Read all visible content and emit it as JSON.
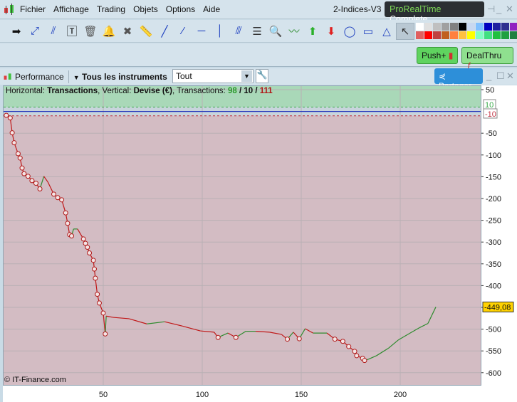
{
  "menu": {
    "items": [
      "Fichier",
      "Affichage",
      "Trading",
      "Objets",
      "Options",
      "Aide"
    ],
    "workspace": "2-Indices-V3",
    "brand_a": "ProRealTime",
    "brand_b": "Complete"
  },
  "toolbar": {
    "icons": [
      "arrow-icon",
      "line-x-icon",
      "parallel-icon",
      "text-icon",
      "trash-icon",
      "bell-icon",
      "tools-icon",
      "ruler-icon",
      "trendline-icon",
      "segment-icon",
      "horizontal-line-icon",
      "vertical-line-icon",
      "fibonacci-icon",
      "indicator-icon",
      "zoom-icon",
      "wave-icon",
      "up-arrow-icon",
      "down-arrow-icon",
      "ellipse-icon",
      "rectangle-icon",
      "triangle-icon",
      "cursor-icon"
    ],
    "palette": [
      "#ffffff",
      "#e0e0e0",
      "#c0c0c0",
      "#a0a0a0",
      "#808080",
      "#000000",
      "#c8d8f0",
      "#80c0ff",
      "#0000c0",
      "#2020a0",
      "#303090",
      "#9020c0",
      "#e06060",
      "#ff0000",
      "#c04040",
      "#c06020",
      "#ff8040",
      "#ffc040",
      "#ffff00",
      "#80ffc0",
      "#40e080",
      "#20c040",
      "#20a040",
      "#208040"
    ]
  },
  "buttons": {
    "push": "Push+",
    "dealthru": "DealThru",
    "share": "Partager"
  },
  "panel": {
    "title": "Performance",
    "instruments": "Tous les instruments",
    "filter": "Tout"
  },
  "info": {
    "h_label": "Horizontal: ",
    "h_val": "Transactions",
    "v_label": ", Vertical: ",
    "v_val": "Devise (€)",
    "t_label": ", Transactions: ",
    "win": "98",
    "sep1": " / ",
    "even": "10",
    "sep2": " / ",
    "loss": "111"
  },
  "copyright": "© IT-Finance.com",
  "chart_data": {
    "type": "line",
    "xlabel": "Transactions",
    "ylabel": "Devise (€)",
    "xlim": [
      -1,
      240
    ],
    "ylim": [
      -620,
      60
    ],
    "x_ticks": [
      50,
      100,
      150,
      200
    ],
    "y_ticks": [
      50,
      -50,
      -100,
      -150,
      -200,
      -250,
      -300,
      -350,
      -400,
      -450,
      -500,
      -550,
      -600
    ],
    "zone_upper": 10,
    "zone_lower": -10,
    "zone_upper_label": "10",
    "zone_lower_label": "-10",
    "last_value_label": "-449,08",
    "colors": {
      "up": "#2e8b2e",
      "down": "#c01818",
      "gain_zone": "#a9d8b8",
      "loss_zone": "#d3bcc3",
      "neutral_zone": "#c8d4dc",
      "zero": "#2233bb"
    },
    "points": [
      [
        1,
        -9
      ],
      [
        3,
        -15
      ],
      [
        4,
        -49
      ],
      [
        5,
        -72
      ],
      [
        7,
        -97
      ],
      [
        8,
        -107
      ],
      [
        9,
        -130
      ],
      [
        10,
        -143
      ],
      [
        12,
        -149
      ],
      [
        14,
        -159
      ],
      [
        16,
        -165
      ],
      [
        18,
        -178
      ],
      [
        20,
        -149
      ],
      [
        22,
        -162
      ],
      [
        25,
        -190
      ],
      [
        27,
        -198
      ],
      [
        29,
        -203
      ],
      [
        31,
        -233
      ],
      [
        32,
        -257
      ],
      [
        33,
        -283
      ],
      [
        34,
        -286
      ],
      [
        35,
        -270
      ],
      [
        37,
        -270
      ],
      [
        40,
        -293
      ],
      [
        41,
        -303
      ],
      [
        42,
        -312
      ],
      [
        43,
        -325
      ],
      [
        45,
        -342
      ],
      [
        45.5,
        -362
      ],
      [
        46,
        -383
      ],
      [
        47,
        -420
      ],
      [
        48,
        -440
      ],
      [
        50,
        -463
      ],
      [
        51,
        -511
      ],
      [
        51.5,
        -470
      ],
      [
        55,
        -473
      ],
      [
        63,
        -476
      ],
      [
        72,
        -488
      ],
      [
        81,
        -483
      ],
      [
        90,
        -493
      ],
      [
        99,
        -504
      ],
      [
        106,
        -507
      ],
      [
        108,
        -519
      ],
      [
        113,
        -509
      ],
      [
        117,
        -519
      ],
      [
        122,
        -505
      ],
      [
        127,
        -505
      ],
      [
        134,
        -507
      ],
      [
        140,
        -512
      ],
      [
        143,
        -523
      ],
      [
        146,
        -507
      ],
      [
        149,
        -522
      ],
      [
        152,
        -499
      ],
      [
        156,
        -509
      ],
      [
        163,
        -509
      ],
      [
        167,
        -523
      ],
      [
        171,
        -528
      ],
      [
        174,
        -540
      ],
      [
        177,
        -551
      ],
      [
        178,
        -561
      ],
      [
        181,
        -567
      ],
      [
        182,
        -572
      ],
      [
        184,
        -569
      ],
      [
        188,
        -561
      ],
      [
        194,
        -544
      ],
      [
        199,
        -525
      ],
      [
        205,
        -509
      ],
      [
        210,
        -496
      ],
      [
        214,
        -487
      ],
      [
        218,
        -449.08
      ]
    ],
    "markers": [
      1,
      3,
      4,
      5,
      7,
      8,
      9,
      10,
      12,
      14,
      16,
      18,
      25,
      27,
      29,
      31,
      32,
      33,
      34,
      40,
      41,
      42,
      43,
      45,
      45.5,
      46,
      47,
      48,
      50,
      51,
      108,
      117,
      143,
      149,
      167,
      171,
      174,
      177,
      178,
      181,
      182
    ]
  }
}
